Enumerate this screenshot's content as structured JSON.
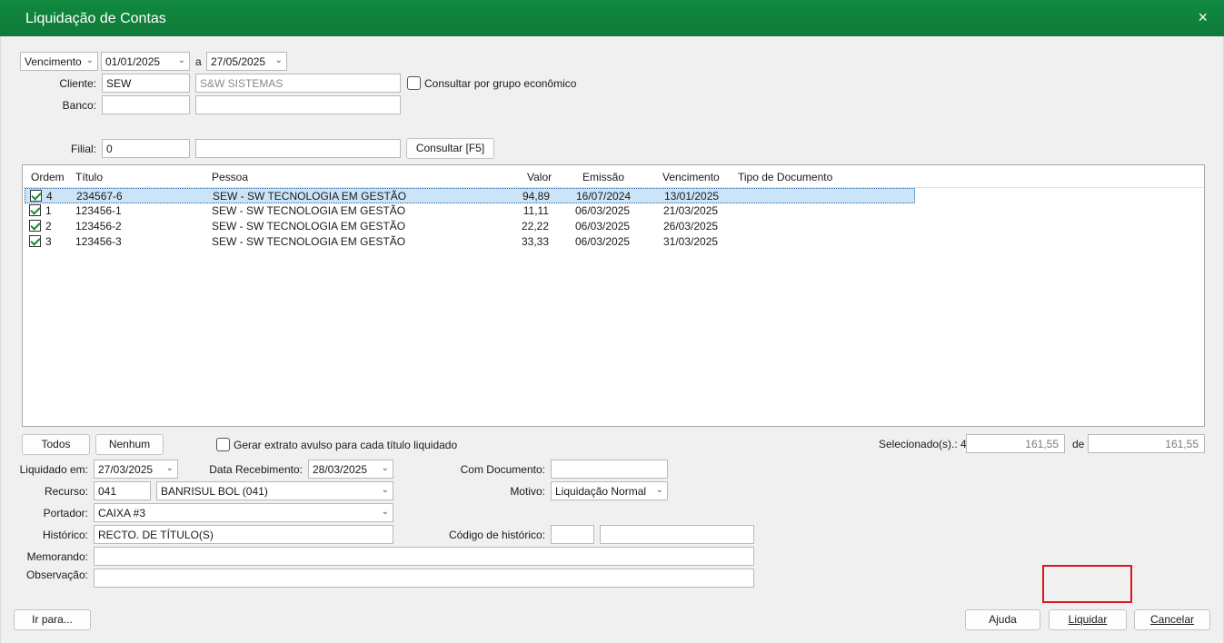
{
  "window": {
    "title": "Liquidação de Contas",
    "close_icon": "×"
  },
  "filters": {
    "date_type": "Vencimento",
    "date_from": "01/01/2025",
    "date_sep": "a",
    "date_to": "27/05/2025",
    "cliente_label": "Cliente:",
    "cliente_code": "SEW",
    "cliente_name": "S&W SISTEMAS",
    "grupo_label": "Consultar por grupo econômico",
    "banco_label": "Banco:",
    "banco_code": "",
    "banco_name": "",
    "filial_label": "Filial:",
    "filial_code": "0",
    "filial_name": "",
    "consultar_button": "Consultar [F5]"
  },
  "grid": {
    "columns": [
      "Ordem",
      "Título",
      "Pessoa",
      "Valor",
      "Emissão",
      "Vencimento",
      "Tipo de Documento"
    ],
    "rows": [
      {
        "ordem": "4",
        "titulo": "234567-6",
        "pessoa": "SEW - SW TECNOLOGIA EM GESTÃO",
        "valor": "94,89",
        "emissao": "16/07/2024",
        "vencimento": "13/01/2025",
        "tipo": ""
      },
      {
        "ordem": "1",
        "titulo": "123456-1",
        "pessoa": "SEW - SW TECNOLOGIA EM GESTÃO",
        "valor": "11,11",
        "emissao": "06/03/2025",
        "vencimento": "21/03/2025",
        "tipo": ""
      },
      {
        "ordem": "2",
        "titulo": "123456-2",
        "pessoa": "SEW - SW TECNOLOGIA EM GESTÃO",
        "valor": "22,22",
        "emissao": "06/03/2025",
        "vencimento": "26/03/2025",
        "tipo": ""
      },
      {
        "ordem": "3",
        "titulo": "123456-3",
        "pessoa": "SEW - SW TECNOLOGIA EM GESTÃO",
        "valor": "33,33",
        "emissao": "06/03/2025",
        "vencimento": "31/03/2025",
        "tipo": ""
      }
    ]
  },
  "selection": {
    "todos_button": "Todos",
    "nenhum_button": "Nenhum",
    "extrato_label": "Gerar extrato avulso para cada título liquidado",
    "selecionados_label": "Selecionado(s).: 4",
    "selecionados_value": "161,55",
    "de_label": "de",
    "total_value": "161,55"
  },
  "form": {
    "liquidado_label": "Liquidado em:",
    "liquidado_value": "27/03/2025",
    "data_receb_label": "Data Recebimento:",
    "data_receb_value": "28/03/2025",
    "com_documento_label": "Com Documento:",
    "com_documento_value": "",
    "recurso_label": "Recurso:",
    "recurso_code": "041",
    "recurso_name": "BANRISUL BOL (041)",
    "motivo_label": "Motivo:",
    "motivo_value": "Liquidação Normal",
    "portador_label": "Portador:",
    "portador_value": "CAIXA #3",
    "historico_label": "Histórico:",
    "historico_value": "RECTO. DE TÍTULO(S)",
    "codigo_hist_label": "Código de histórico:",
    "codigo_hist_code": "",
    "codigo_hist_name": "",
    "memorando_label": "Memorando:",
    "memorando_value": "",
    "observacao_label": "Observação:",
    "observacao_value": ""
  },
  "footer": {
    "ir_para_button": "Ir para...",
    "ajuda_button": "Ajuda",
    "liquidar_button": "Liquidar",
    "cancelar_button": "Cancelar"
  },
  "colors": {
    "titlebar": "#118a3f",
    "highlight": "#e0141e",
    "selected_row": "#cce4f7"
  }
}
